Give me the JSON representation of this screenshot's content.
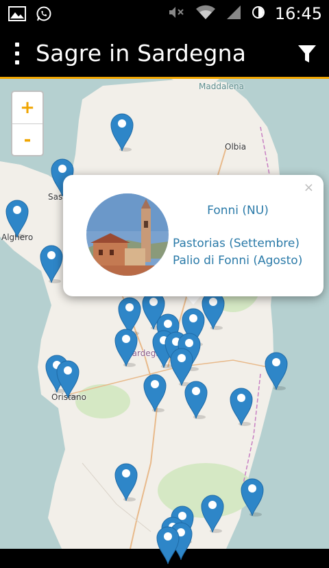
{
  "app": {
    "title": "Sagre in Sardegna"
  },
  "status_bar": {
    "time": "16:45"
  },
  "map": {
    "places": [
      {
        "name": "Maddalena"
      },
      {
        "name": "Olbia"
      },
      {
        "name": "Sassari"
      },
      {
        "name": "Alghero"
      },
      {
        "name": "Sardegna"
      },
      {
        "name": "Oristano"
      }
    ],
    "zoom_in_label": "+",
    "zoom_out_label": "-"
  },
  "popup": {
    "close_label": "×",
    "town": "Fonni (NU)",
    "events": [
      "Pastorias (Settembre)",
      "Palio di Fonni (Agosto)"
    ]
  },
  "colors": {
    "accent": "#f0a500",
    "marker": "#2e86c8",
    "link": "#2a7aa8"
  }
}
